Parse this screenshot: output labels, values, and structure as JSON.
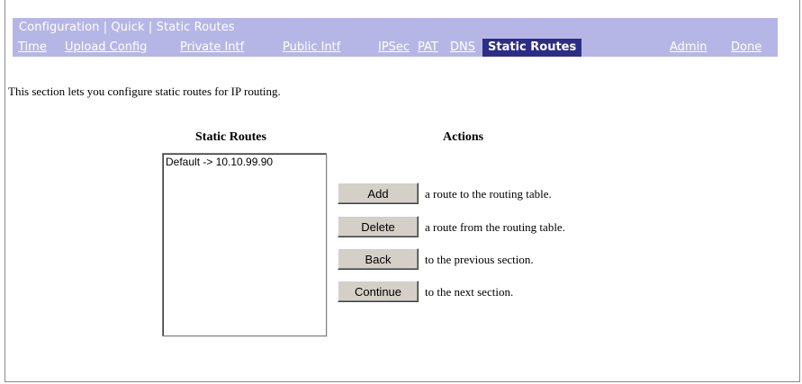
{
  "breadcrumb": {
    "configuration": "Configuration",
    "sep1": " | ",
    "quick": "Quick",
    "sep2": " | ",
    "static_routes": "Static Routes"
  },
  "tabs": [
    {
      "label": "Time"
    },
    {
      "label": "Upload Config"
    },
    {
      "label": "Private Intf"
    },
    {
      "label": "Public Intf"
    },
    {
      "label": "IPSec"
    },
    {
      "label": "PAT"
    },
    {
      "label": "DNS"
    },
    {
      "label": "Static Routes",
      "active": true
    },
    {
      "label": "Admin"
    },
    {
      "label": "Done"
    }
  ],
  "intro_text": "This section lets you configure static routes for IP routing.",
  "routes_header": "Static Routes",
  "actions_header": "Actions",
  "routes": [
    "Default -> 10.10.99.90"
  ],
  "actions": [
    {
      "button": "Add",
      "description": "a route to the routing table."
    },
    {
      "button": "Delete",
      "description": "a route from the routing table."
    },
    {
      "button": "Back",
      "description": "to the previous section."
    },
    {
      "button": "Continue",
      "description": "to the next section."
    }
  ],
  "colors": {
    "nav_background": "#b6b6e6",
    "active_tab_background": "#2d2d87",
    "button_face": "#d4d0c8"
  }
}
